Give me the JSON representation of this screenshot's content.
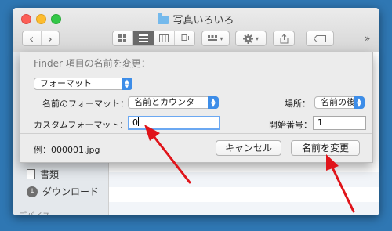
{
  "window": {
    "title": "写真いろいろ"
  },
  "toolbar": {
    "back_glyph": "‹",
    "forward_glyph": "›",
    "more_glyph": "»"
  },
  "sidebar": {
    "items": [
      {
        "label": "書類",
        "icon": "document-icon"
      },
      {
        "label": "ダウンロード",
        "icon": "download-icon"
      }
    ],
    "section_header": "デバイス"
  },
  "dialog": {
    "title": "Finder 項目の名前を変更：",
    "mode_select": "フォーマット",
    "name_format_label": "名前のフォーマット：",
    "name_format_value": "名前とカウンタ",
    "location_label": "場所：",
    "location_value": "名前の後",
    "custom_format_label": "カスタムフォーマット：",
    "custom_format_value": "0",
    "start_number_label": "開始番号：",
    "start_number_value": "1",
    "example": "例：000001.jpg",
    "cancel_label": "キャンセル",
    "rename_label": "名前を変更"
  },
  "colors": {
    "accent": "#3d8de8",
    "annotation_arrow": "#e0141a"
  }
}
